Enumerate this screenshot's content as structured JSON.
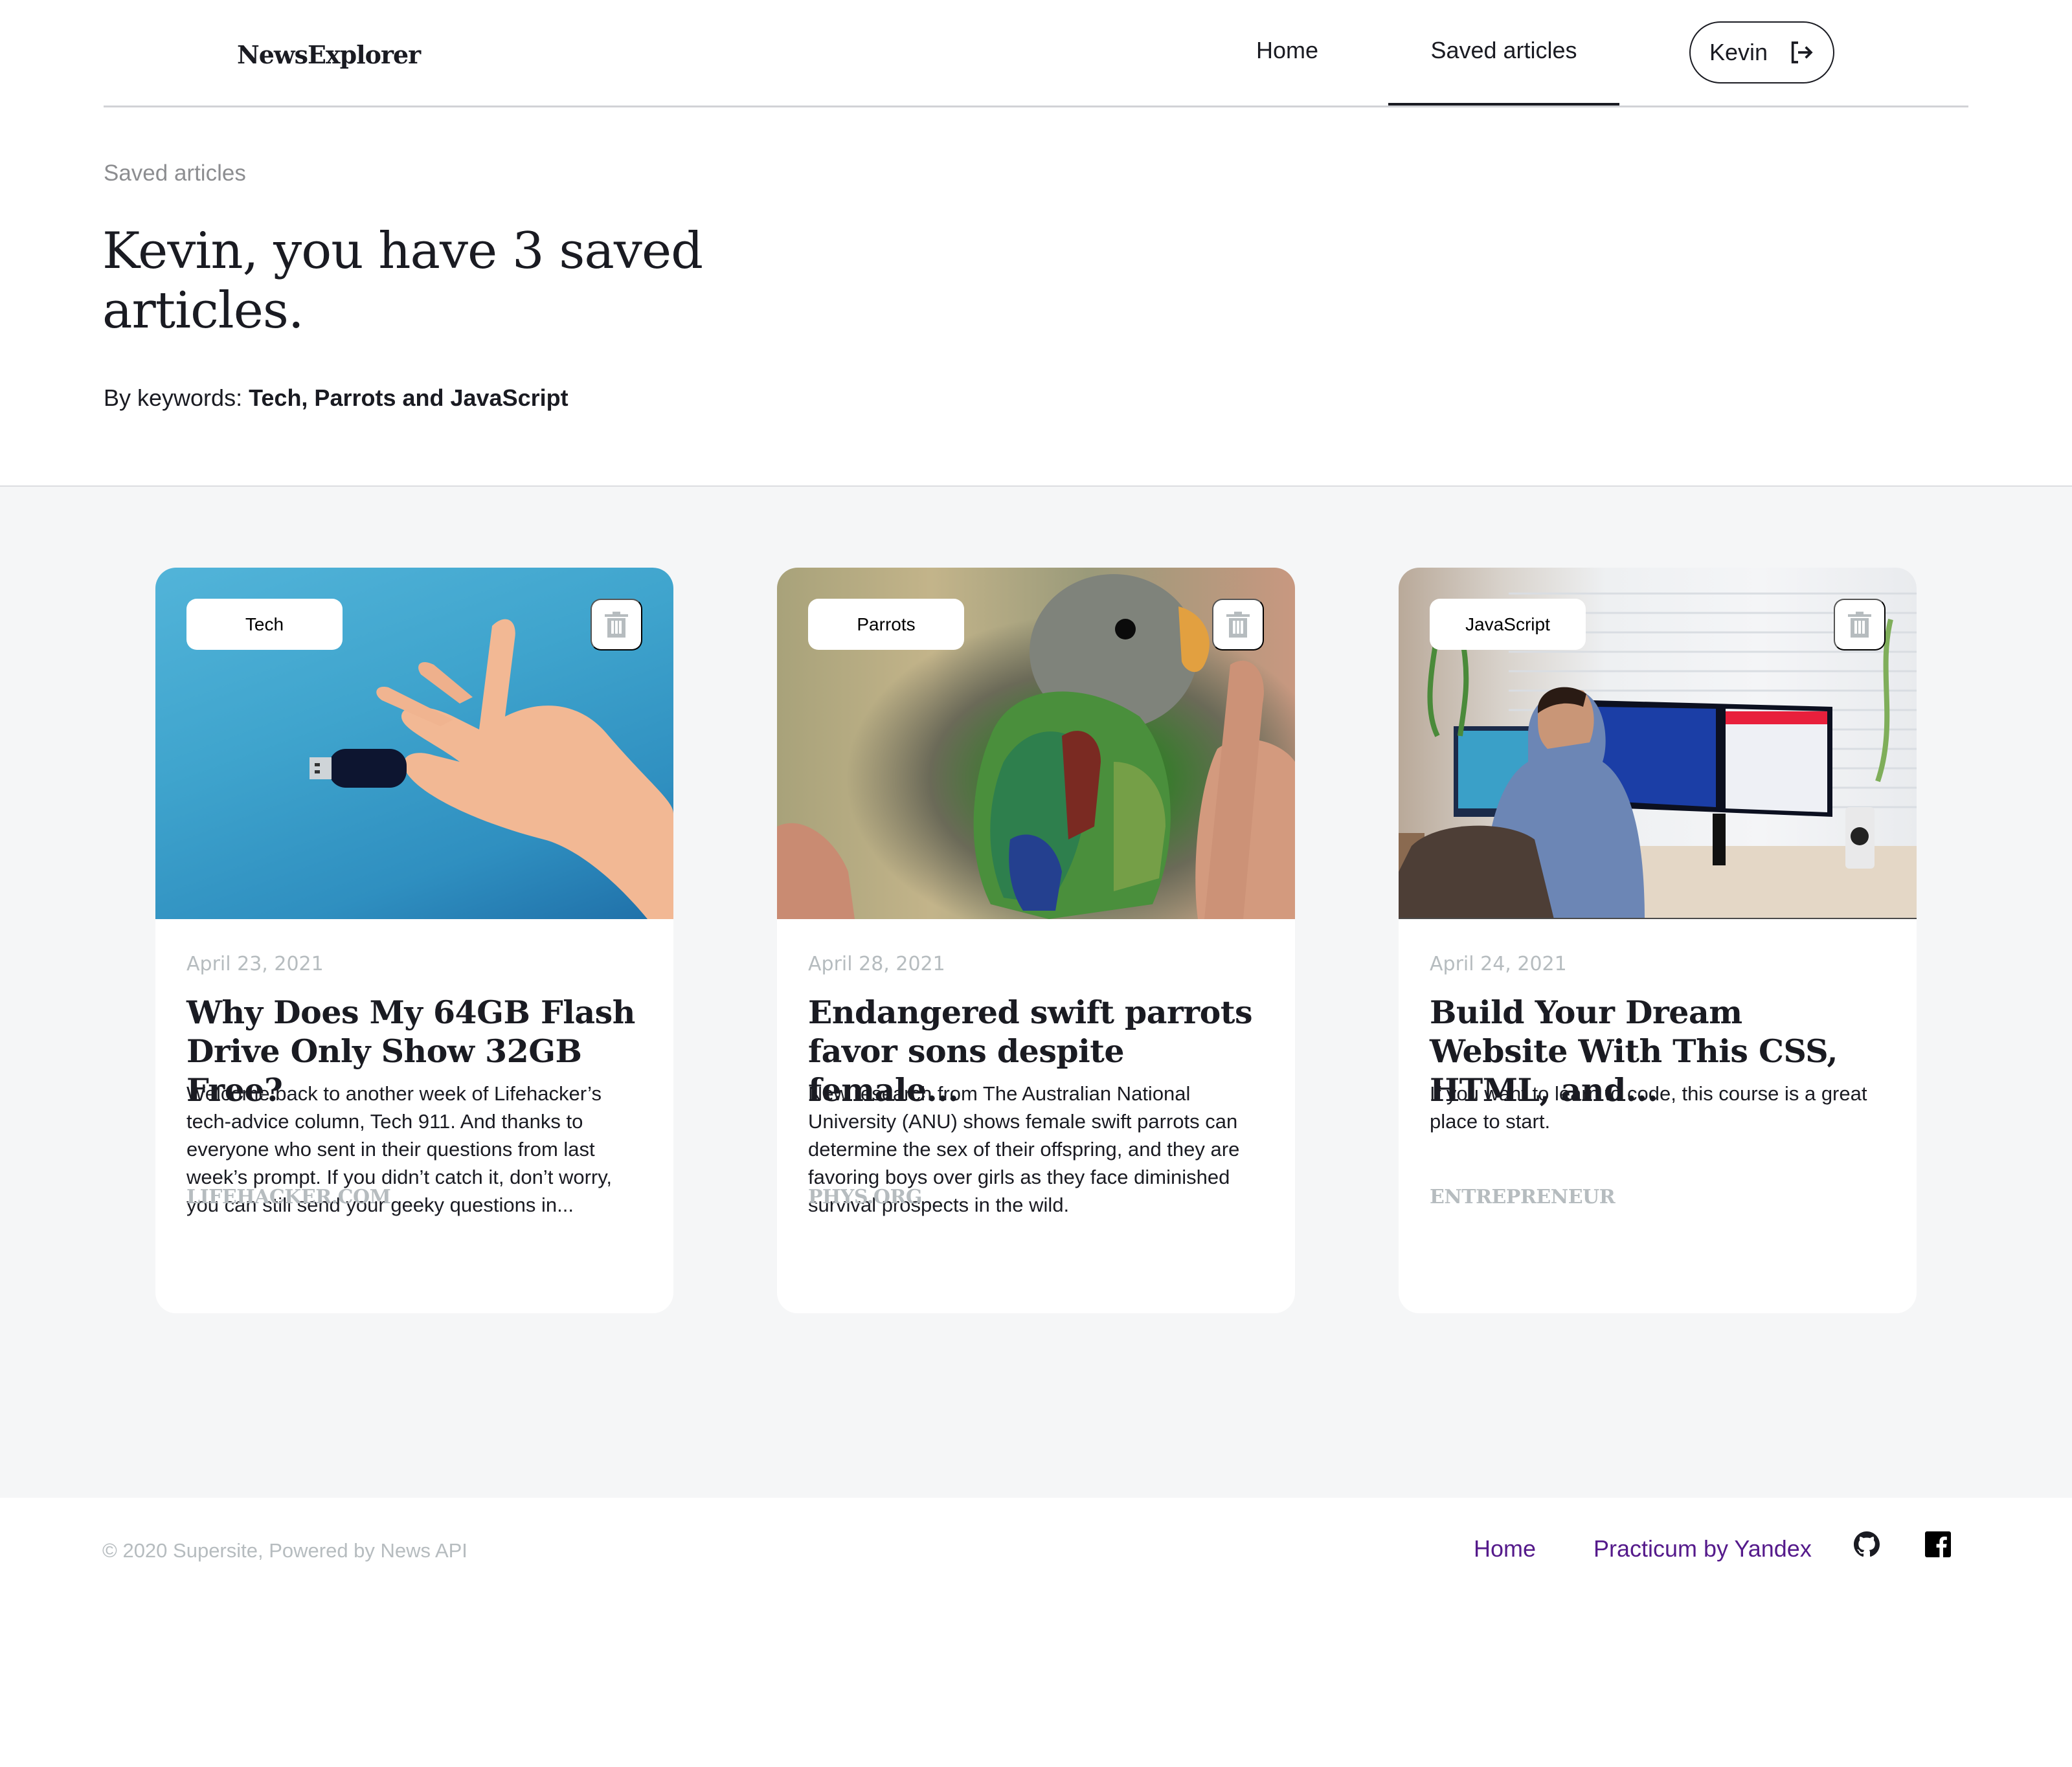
{
  "header": {
    "logo": "NewsExplorer",
    "nav": [
      {
        "label": "Home",
        "active": false
      },
      {
        "label": "Saved articles",
        "active": true
      }
    ],
    "user_button": {
      "name": "Kevin",
      "icon": "logout-icon"
    }
  },
  "intro": {
    "breadcrumb": "Saved articles",
    "title": "Kevin, you have 3 saved articles.",
    "keywords_label": "By keywords: ",
    "keywords_value": "Tech, Parrots and JavaScript"
  },
  "cards": [
    {
      "keyword": "Tech",
      "delete_icon": "trash-icon",
      "date": "April 23, 2021",
      "title": "Why Does My 64GB Flash Drive Only Show 32GB Free?",
      "text": "Welcome back to another week of Lifehacker’s tech-advice column, Tech 911. And thanks to everyone who sent in their questions from last week’s prompt. If you didn’t catch it, don’t worry, you can still send your geeky questions in...",
      "source": "LIFEHACKER.COM",
      "image": "hand holding a USB flash drive on blue background"
    },
    {
      "keyword": "Parrots",
      "delete_icon": "trash-icon",
      "date": "April 28, 2021",
      "title": "Endangered swift parrots favor sons despite female...",
      "text": "New research from The Australian National University (ANU) shows female swift parrots can determine the sex of their offspring, and they are favoring boys over girls as they face diminished survival prospects in the wild.",
      "source": "PHYS.ORG",
      "image": "young swift parrot held in a hand"
    },
    {
      "keyword": "JavaScript",
      "delete_icon": "trash-icon",
      "date": "April 24, 2021",
      "title": "Build Your Dream Website With This CSS, HTML, and...",
      "text": "If you want to learn to code, this course is a great place to start.",
      "source": "ENTREPRENEUR",
      "image": "man coding at a desk with a curved monitor"
    }
  ],
  "footer": {
    "copyright": "© 2020 Supersite, Powered by News API",
    "links": [
      {
        "label": "Home"
      },
      {
        "label": "Practicum by Yandex"
      }
    ],
    "social": [
      "github-icon",
      "facebook-icon"
    ]
  },
  "colors": {
    "text": "#1a1b22",
    "muted": "#b6bcbf",
    "section_bg": "#f5f6f7",
    "link_visited": "#551a8b"
  }
}
